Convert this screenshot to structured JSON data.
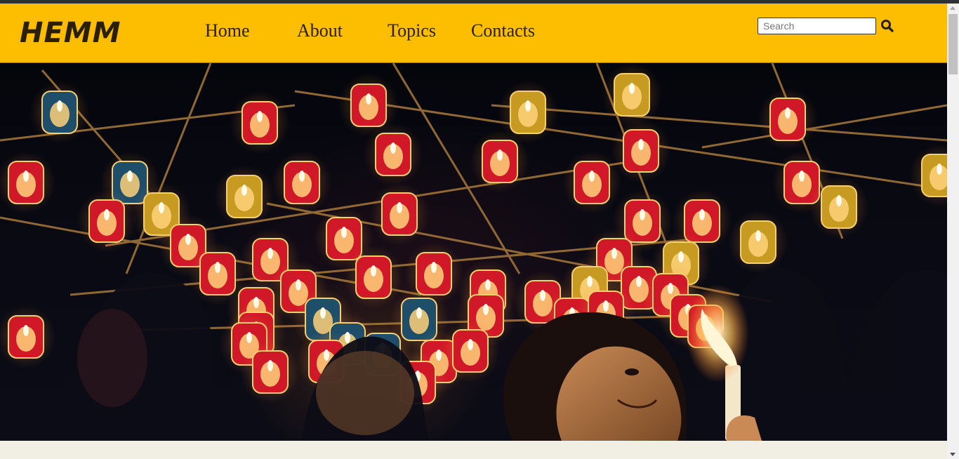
{
  "brand": {
    "logo_text": "HEMM"
  },
  "nav": {
    "items": [
      {
        "label": "Home"
      },
      {
        "label": "About"
      },
      {
        "label": "Topics"
      },
      {
        "label": "Contacts"
      }
    ]
  },
  "search": {
    "placeholder": "Search",
    "value": "",
    "icon": "search-icon"
  },
  "hero": {
    "image_subject": "child holding candle beneath hanging red lanterns at night",
    "slide_count": 5
  },
  "colors": {
    "navbar": "#fdbd00",
    "nav_text": "#2a1f00",
    "page_background": "#f1efe4",
    "lantern_red": "#d01828",
    "lantern_glow": "#ffd27a"
  }
}
